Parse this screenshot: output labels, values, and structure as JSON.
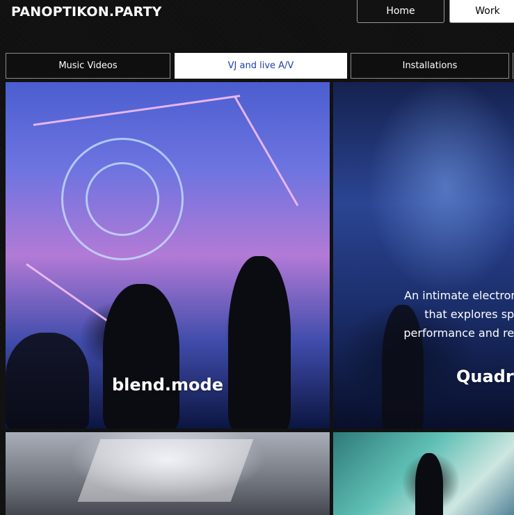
{
  "brand": {
    "title": "PANOPTIKON.PARTY"
  },
  "topnav": {
    "home": "Home",
    "work": "Work"
  },
  "tabs": {
    "music_videos": "Music Videos",
    "vj_live": "VJ and live A/V",
    "installations": "Installations"
  },
  "tiles": {
    "blend": {
      "title": "blend.mode"
    },
    "quadra": {
      "desc_line1": "An intimate electroni",
      "desc_line2": "that explores spa",
      "desc_line3": "performance and rea",
      "title": "Quadra"
    }
  },
  "colors": {
    "active_tab_text": "#1e3fae",
    "background": "#0d0d0d"
  }
}
